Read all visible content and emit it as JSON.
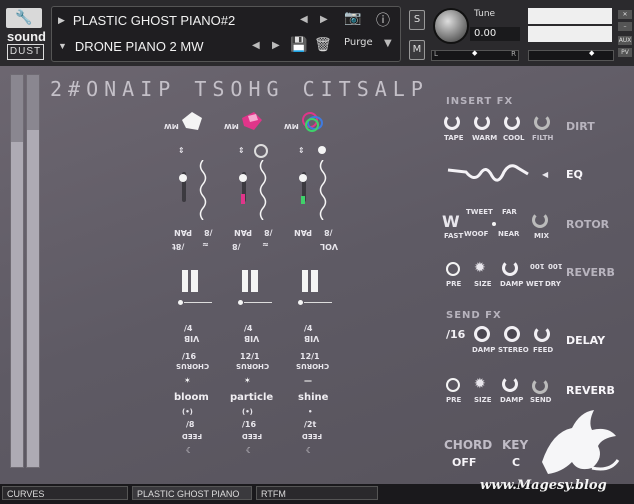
{
  "header": {
    "brand_line1": "sound",
    "brand_line2": "DUST",
    "instrument_name": "PLASTIC GHOST PIANO#2",
    "snapshot_name": "DRONE PIANO 2 MW",
    "purge_label": "Purge",
    "solo_label": "S",
    "mute_label": "M",
    "tune_label": "Tune",
    "tune_value": "0.00",
    "pan_left": "L",
    "pan_right": "R",
    "side_labels": [
      "AUX",
      "PV"
    ]
  },
  "main": {
    "title_mirrored": "2#ONAIP TSOHG CITSALP",
    "layers": [
      {
        "mw": "MW",
        "pan_label": "PAN",
        "vol_label": "/8",
        "rate_label": "/8t",
        "vib_label": "/4",
        "vib_caption": "VIB",
        "chorus_value": "/16",
        "chorus_caption": "CHORUS",
        "name": "bloom",
        "feed_value": "/8",
        "feed_caption": "FEED",
        "accent": "#ffffff"
      },
      {
        "mw": "MW",
        "pan_label": "PAN",
        "vol_label": "/8",
        "rate_label": "/8",
        "vib_label": "/4",
        "vib_caption": "VIB",
        "chorus_value": "12/1",
        "chorus_caption": "CHORUS",
        "name": "particle",
        "feed_value": "/16",
        "feed_caption": "FEED",
        "accent": "#e0358a"
      },
      {
        "mw": "MW",
        "pan_label": "PAN",
        "vol_label": "/8",
        "rate_label": "VOL",
        "vib_label": "/4",
        "vib_caption": "VIB",
        "chorus_value": "12/1",
        "chorus_caption": "CHORUS",
        "name": "shine",
        "feed_value": "/2t",
        "feed_caption": "FEED",
        "accent": "#3fd26a"
      }
    ]
  },
  "insert_fx": {
    "title": "INSERT FX",
    "dirt": {
      "name": "DIRT",
      "knobs": [
        "TAPE",
        "WARM",
        "COOL",
        "FILTH"
      ]
    },
    "eq": {
      "name": "EQ"
    },
    "rotor": {
      "name": "ROTOR",
      "labels": [
        "FAST",
        "TWEET",
        "WOOF",
        "FAR",
        "NEAR",
        "MIX"
      ]
    },
    "reverb": {
      "name": "REVERB",
      "labels": [
        "PRE",
        "SIZE",
        "DAMP",
        "WET",
        "DRY"
      ],
      "wet_value": "100",
      "dry_value": "100"
    }
  },
  "send_fx": {
    "title": "SEND FX",
    "delay": {
      "name": "DELAY",
      "time_value": "/16",
      "knobs": [
        "DAMP",
        "STEREO",
        "FEED"
      ]
    },
    "reverb": {
      "name": "REVERB",
      "knobs": [
        "PRE",
        "SIZE",
        "DAMP",
        "SEND"
      ]
    }
  },
  "chord_key": {
    "chord_label": "CHORD",
    "chord_value": "OFF",
    "key_label": "KEY",
    "key_value": "C"
  },
  "tabs": [
    "CURVES",
    "PLASTIC GHOST PIANO",
    "RTFM"
  ],
  "watermark": "www.Magesy.blog",
  "meters": {
    "left_level": 0.83,
    "right_level": 0.86
  }
}
